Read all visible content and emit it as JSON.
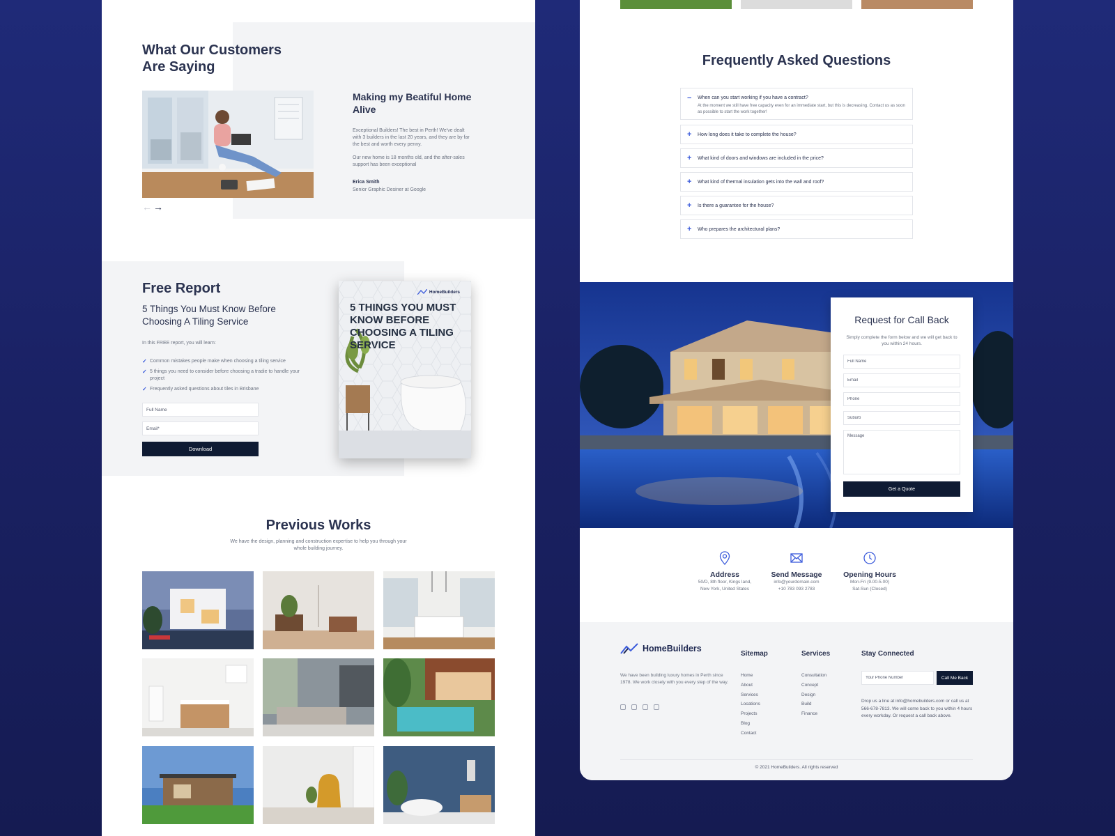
{
  "testimonial": {
    "section_title": "What Our Customers Are Saying",
    "heading": "Making my Beatiful Home Alive",
    "paragraph1": "Exceptional Builders! The best in Perth! We've dealt with 3 builders in the last 20 years, and they are by far the best and worth every penny.",
    "paragraph2": "Our new home is 18 months old, and the after-sales support has been exceptional",
    "author_name": "Erica Smith",
    "author_role": "Senior Graphic Desiner at Google",
    "prev_arrow": "←",
    "next_arrow": "→"
  },
  "free_report": {
    "title": "Free Report",
    "subtitle": "5 Things You Must Know Before Choosing A Tiling Service",
    "intro": "In this FREE report, you will learn:",
    "items": [
      "Common mistakes people make when choosing a tiling service",
      "5 things you need to consider before choosing a tradie to handle your project",
      "Frequently asked questions about tiles in Brisbane"
    ],
    "name_placeholder": "Full Name",
    "email_placeholder": "Email*",
    "button": "Download",
    "book_brand": "HomeBuilders",
    "book_title": "5 THINGS YOU MUST KNOW BEFORE CHOOSING A TILING SERVICE"
  },
  "previous_works": {
    "title": "Previous Works",
    "description": "We have the design, planning and construction expertise to help you through your whole building journey."
  },
  "faq": {
    "title": "Frequently Asked Questions",
    "items": [
      {
        "question": "When can you start working if you have a contract?",
        "answer": "At the moment we still have free capacity even for an immediate start, but this is decreasing. Contact us as soon as possible to start the work together!",
        "sign": "−"
      },
      {
        "question": "How long does it take to complete the house?",
        "sign": "+"
      },
      {
        "question": "What kind of doors and windows are included in the price?",
        "sign": "+"
      },
      {
        "question": "What kind of thermal insulation gets into the wall and roof?",
        "sign": "+"
      },
      {
        "question": "Is there a guarantee for the house?",
        "sign": "+"
      },
      {
        "question": "Who prepares the architectural plans?",
        "sign": "+"
      }
    ]
  },
  "callback": {
    "title": "Request for Call Back",
    "description": "Simply complete the form below and we will get back to you within 24 hours.",
    "full_name_placeholder": "Full Name",
    "email_placeholder": "Email",
    "phone_placeholder": "Phone",
    "suburb_placeholder": "Suburb",
    "message_placeholder": "Message",
    "button": "Get a Quote"
  },
  "contact": {
    "address_label": "Address",
    "address_line1": "50/D, 8th floor, Kings land,",
    "address_line2": "New York, United States",
    "message_label": "Send Message",
    "message_line1": "info@yourdomain.com",
    "message_line2": "+10 783 093 2783",
    "hours_label": "Opening Hours",
    "hours_line1": "Mon-Fri (9.00-5.00)",
    "hours_line2": "Sat-Sun (Closed)"
  },
  "footer": {
    "brand": "HomeBuilders",
    "about": "We have been building luxury homes in Perth since 1978. We work closely with you every step of the way.",
    "sitemap_title": "Sitemap",
    "sitemap": [
      "Home",
      "About",
      "Services",
      "Locations",
      "Projects",
      "Blog",
      "Contact"
    ],
    "services_title": "Services",
    "services": [
      "Consultation",
      "Concept",
      "Design",
      "Build",
      "Finance"
    ],
    "stay_title": "Stay Connected",
    "phone_placeholder": "Your Phone Number",
    "callme_button": "Call Me Back",
    "note": "Drop us a line at info@homebuilders.com or call us at 566-678-7813. We will come back to you within 4 hours every workday. Or request a call back above.",
    "copyright": "© 2021 HomeBuilders. All rights reserved"
  },
  "colors": {
    "background": "#1f2a78",
    "navy_button": "#0f1b33",
    "accent": "#3b5bdb",
    "heading": "#2b3350",
    "muted": "#6b7280"
  }
}
